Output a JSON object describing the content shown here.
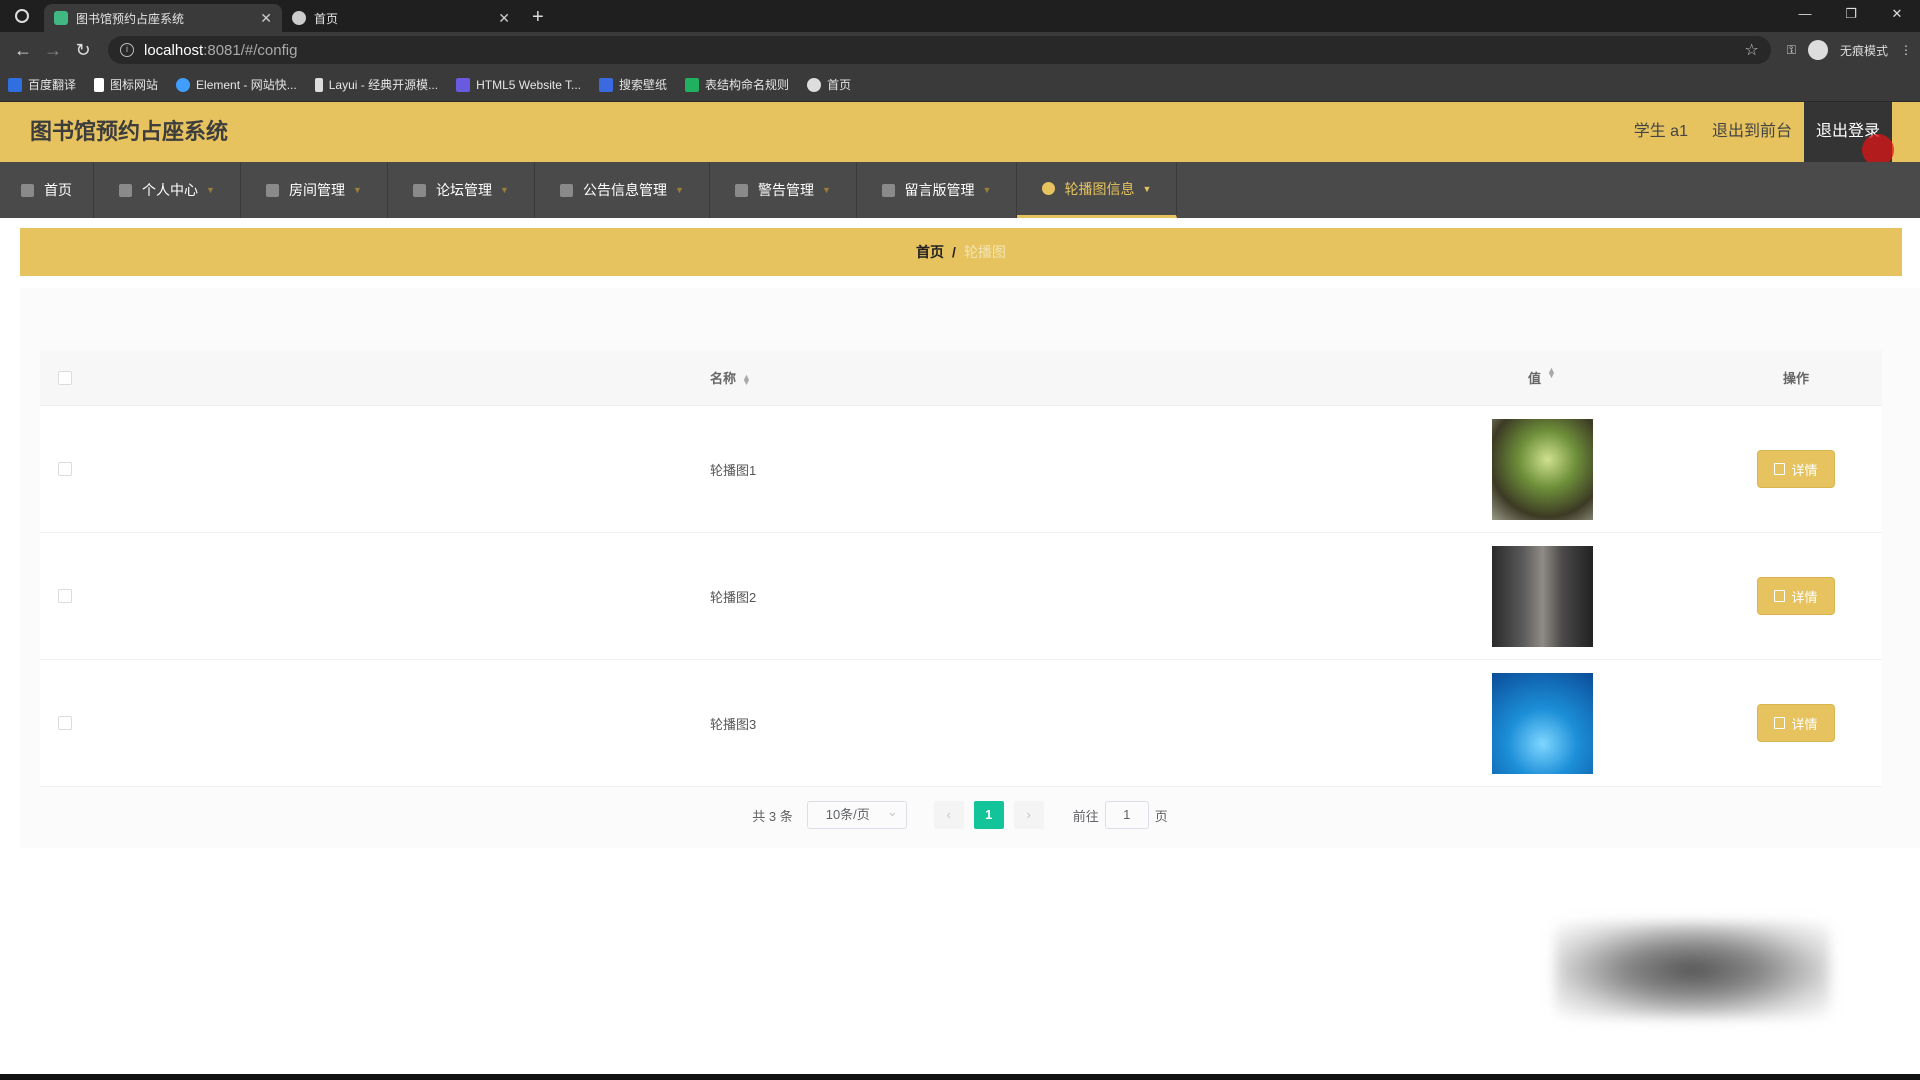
{
  "browser": {
    "tabs": [
      {
        "title": "图书馆预约占座系统",
        "active": true,
        "favicon_color": "#41b883"
      },
      {
        "title": "首页",
        "active": false,
        "favicon_color": "#cccccc"
      }
    ],
    "url_host": "localhost",
    "url_path": ":8081/#/config",
    "incognito_label": "无痕模式",
    "bookmarks": [
      {
        "label": "百度翻译",
        "color": "#2f6fe0"
      },
      {
        "label": "图标网站",
        "color": "#ffffff"
      },
      {
        "label": "Element - 网站快...",
        "color": "#409eff"
      },
      {
        "label": "Layui - 经典开源模...",
        "color": "#dddddd"
      },
      {
        "label": "HTML5 Website T...",
        "color": "#6a5ae0"
      },
      {
        "label": "搜索壁纸",
        "color": "#3b6ae0"
      },
      {
        "label": "表结构命名规则",
        "color": "#20b060"
      },
      {
        "label": "首页",
        "color": "#dddddd"
      }
    ]
  },
  "header": {
    "title": "图书馆预约占座系统",
    "user": "学生 a1",
    "front_link": "退出到前台",
    "logout": "退出登录"
  },
  "menu": [
    {
      "label": "首页",
      "active": false
    },
    {
      "label": "个人中心",
      "active": false
    },
    {
      "label": "房间管理",
      "active": false
    },
    {
      "label": "论坛管理",
      "active": false
    },
    {
      "label": "公告信息管理",
      "active": false
    },
    {
      "label": "警告管理",
      "active": false
    },
    {
      "label": "留言版管理",
      "active": false
    },
    {
      "label": "轮播图信息",
      "active": true
    }
  ],
  "breadcrumb": {
    "home": "首页",
    "separator": "/",
    "current": "轮播图"
  },
  "table": {
    "columns": {
      "name": "名称",
      "value": "值",
      "ops": "操作"
    },
    "rows": [
      {
        "name": "轮播图1",
        "action": "详情"
      },
      {
        "name": "轮播图2",
        "action": "详情"
      },
      {
        "name": "轮播图3",
        "action": "详情"
      }
    ]
  },
  "pagination": {
    "total": "共 3 条",
    "page_size": "10条/页",
    "prev": "‹",
    "current_page": "1",
    "next": "›",
    "goto_label": "前往",
    "goto_value": "1",
    "goto_suffix": "页"
  },
  "colors": {
    "accent": "#e6c35f",
    "menu_bg": "#4a4a4a",
    "pager_active": "#13c49a"
  }
}
